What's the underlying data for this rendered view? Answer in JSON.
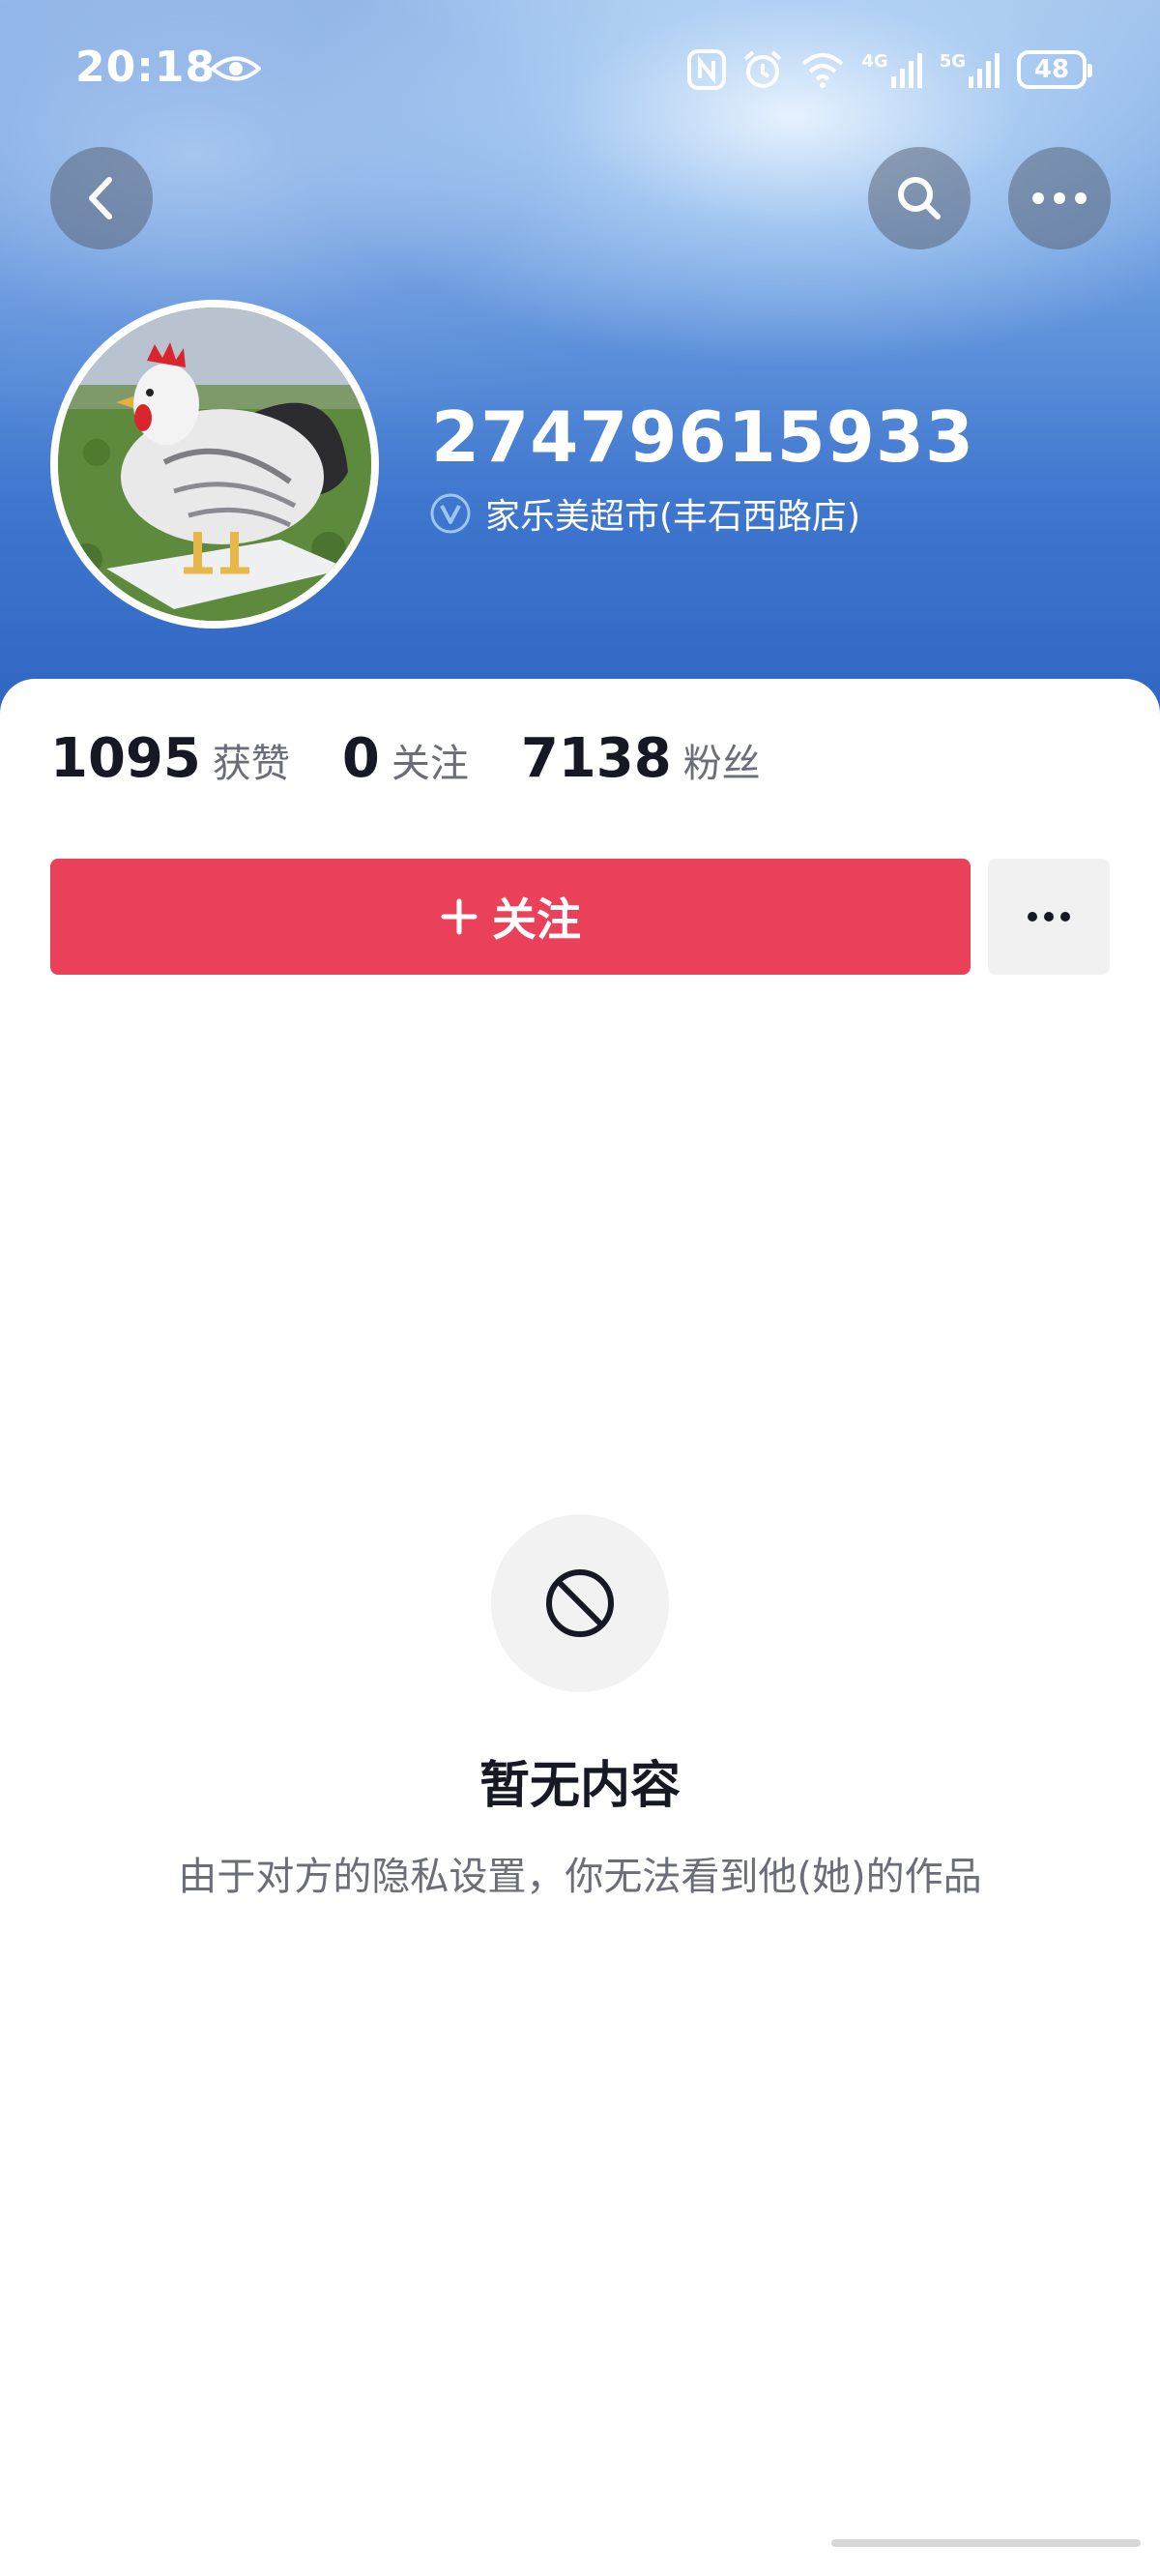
{
  "status_bar": {
    "time": "20:18",
    "network_1": "4G",
    "network_2": "5G",
    "battery": "48"
  },
  "profile": {
    "username": "27479615933",
    "verified_name": "家乐美超市(丰石西路店)"
  },
  "stats": [
    {
      "value": "1095",
      "label": "获赞"
    },
    {
      "value": "0",
      "label": "关注"
    },
    {
      "value": "7138",
      "label": "粉丝"
    }
  ],
  "actions": {
    "follow_label": "关注"
  },
  "empty_state": {
    "title": "暂无内容",
    "description": "由于对方的隐私设置，你无法看到他(她)的作品"
  },
  "colors": {
    "follow_button": "#ea4059",
    "header_blue": "#3f77cf"
  },
  "icons": [
    "eye-icon",
    "nfc-icon",
    "alarm-icon",
    "wifi-icon",
    "signal-icon",
    "back-arrow-icon",
    "search-icon",
    "more-dots-icon",
    "verified-badge-icon",
    "plus-icon",
    "block-icon"
  ]
}
